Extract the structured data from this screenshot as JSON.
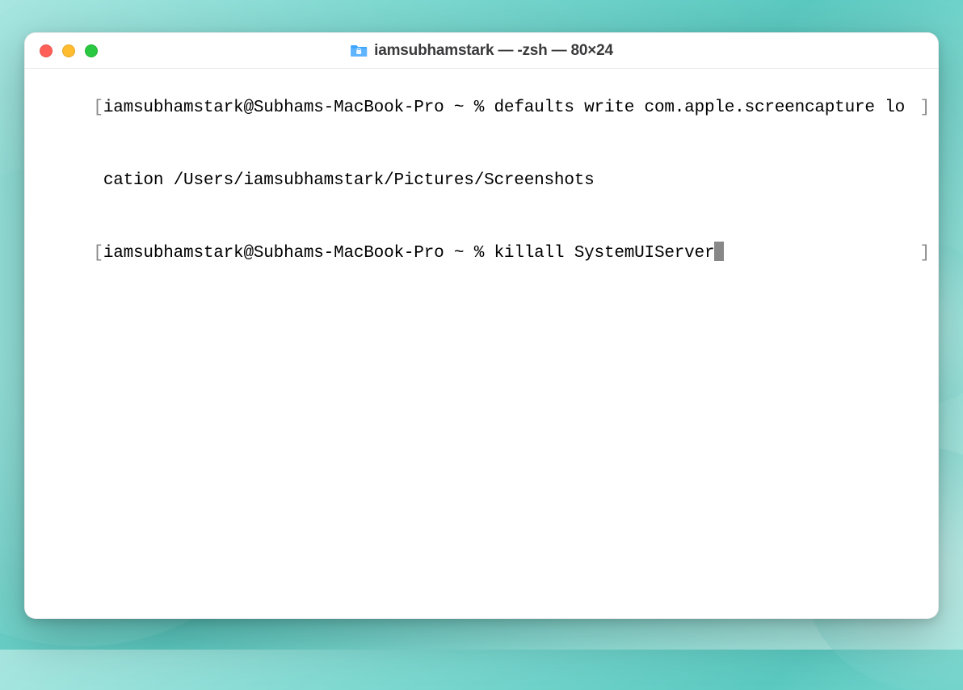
{
  "window": {
    "title": "iamsubhamstark — -zsh — 80×24"
  },
  "terminal": {
    "lines": [
      {
        "left_bracket": "[",
        "prompt": "iamsubhamstark@Subhams-MacBook-Pro ~ % ",
        "command": "defaults write com.apple.screencapture lo",
        "right_bracket": "]",
        "has_cursor": false,
        "wrapped": true
      },
      {
        "left_bracket": " ",
        "prompt": "",
        "command": "cation /Users/iamsubhamstark/Pictures/Screenshots",
        "right_bracket": "",
        "has_cursor": false,
        "wrapped": false
      },
      {
        "left_bracket": "[",
        "prompt": "iamsubhamstark@Subhams-MacBook-Pro ~ % ",
        "command": "killall SystemUIServer",
        "right_bracket": "]",
        "has_cursor": true,
        "wrapped": false
      }
    ]
  }
}
